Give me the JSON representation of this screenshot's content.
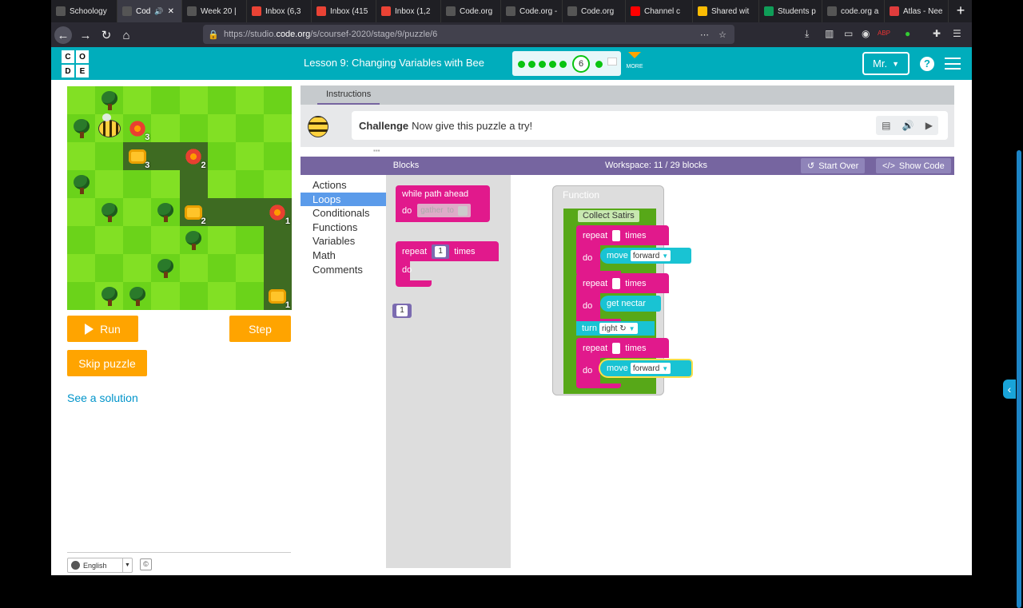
{
  "browser": {
    "tabs": [
      {
        "title": "Schoology",
        "icon": "schoology-icon",
        "color": "#ffffff"
      },
      {
        "title": "Cod",
        "icon": "codeorg-icon",
        "color": "#ffffff",
        "active": true
      },
      {
        "title": "Week 20 |",
        "icon": "schoology-icon",
        "color": "#ffffff"
      },
      {
        "title": "Inbox (6,3",
        "icon": "gmail-icon",
        "color": "#ea4335"
      },
      {
        "title": "Inbox (415",
        "icon": "gmail-icon",
        "color": "#ea4335"
      },
      {
        "title": "Inbox (1,2",
        "icon": "gmail-icon",
        "color": "#ea4335"
      },
      {
        "title": "Code.org",
        "icon": "codeorg-icon",
        "color": "#ffffff"
      },
      {
        "title": "Code.org -",
        "icon": "codeorg-icon",
        "color": "#ffffff"
      },
      {
        "title": "Code.org",
        "icon": "codeorg-icon",
        "color": "#ffffff"
      },
      {
        "title": "Channel c",
        "icon": "youtube-icon",
        "color": "#ff0000"
      },
      {
        "title": "Shared wit",
        "icon": "drive-icon",
        "color": "#fbbc04"
      },
      {
        "title": "Students p",
        "icon": "sheets-icon",
        "color": "#0f9d58"
      },
      {
        "title": "code.org a",
        "icon": "google-icon",
        "color": "#ffffff"
      },
      {
        "title": "Atlas - Nee",
        "icon": "atlas-icon",
        "color": "#e03c3c"
      }
    ],
    "url_prefix": "https://studio.",
    "url_host": "code.org",
    "url_path": "/s/coursef-2020/stage/9/puzzle/6"
  },
  "header": {
    "logo_letters": [
      "C",
      "O",
      "D",
      "E"
    ],
    "lesson_title": "Lesson 9: Changing Variables with Bee",
    "current_puzzle": "6",
    "more_label": "MORE",
    "user_label": "Mr.",
    "accent_color": "#00adbc"
  },
  "maze": {
    "rows": [
      [
        "g",
        "tree",
        "g",
        "g",
        "g",
        "g",
        "g",
        "g"
      ],
      [
        "tree",
        "bee",
        "flower:3",
        "g",
        "g",
        "g",
        "g",
        "g"
      ],
      [
        "g",
        "g",
        "comb:3",
        "path",
        "flower:2",
        "g",
        "g",
        "g"
      ],
      [
        "tree",
        "g",
        "g",
        "g",
        "path",
        "g",
        "g",
        "g"
      ],
      [
        "g",
        "tree",
        "g",
        "tree",
        "comb:2",
        "path",
        "path",
        "flower:1"
      ],
      [
        "g",
        "g",
        "g",
        "g",
        "tree",
        "g",
        "g",
        "path"
      ],
      [
        "g",
        "g",
        "g",
        "tree",
        "g",
        "g",
        "g",
        "path"
      ],
      [
        "g",
        "tree",
        "tree",
        "g",
        "g",
        "g",
        "g",
        "comb:1"
      ]
    ]
  },
  "controls": {
    "run_label": "Run",
    "step_label": "Step",
    "skip_label": "Skip puzzle",
    "solution_label": "See a solution",
    "language": "English",
    "copyright": "©"
  },
  "instructions": {
    "tab_label": "Instructions",
    "challenge_label": "Challenge",
    "text": "Now give this puzzle a try!"
  },
  "workspace": {
    "blocks_label": "Blocks",
    "count_label": "Workspace: 11 / 29 blocks",
    "start_over_label": "Start Over",
    "show_code_label": "Show Code",
    "categories": [
      "Actions",
      "Loops",
      "Conditionals",
      "Functions",
      "Variables",
      "Math",
      "Comments"
    ],
    "selected_category": "Loops"
  },
  "flyout": {
    "while_label": "while path ahead",
    "do_label": "do",
    "ghost_gather": "gather",
    "ghost_to": "to",
    "repeat_label": "repeat",
    "times_label": "times",
    "repeat_value": "1",
    "number_value": "1"
  },
  "function_def": {
    "header": "Function",
    "name": "Collect Satirs",
    "repeat_label": "repeat",
    "times_label": "times",
    "do_label": "do",
    "move_label": "move",
    "direction": "forward",
    "nectar_label": "get nectar",
    "turn_label": "turn",
    "turn_dir": "right ↻"
  }
}
